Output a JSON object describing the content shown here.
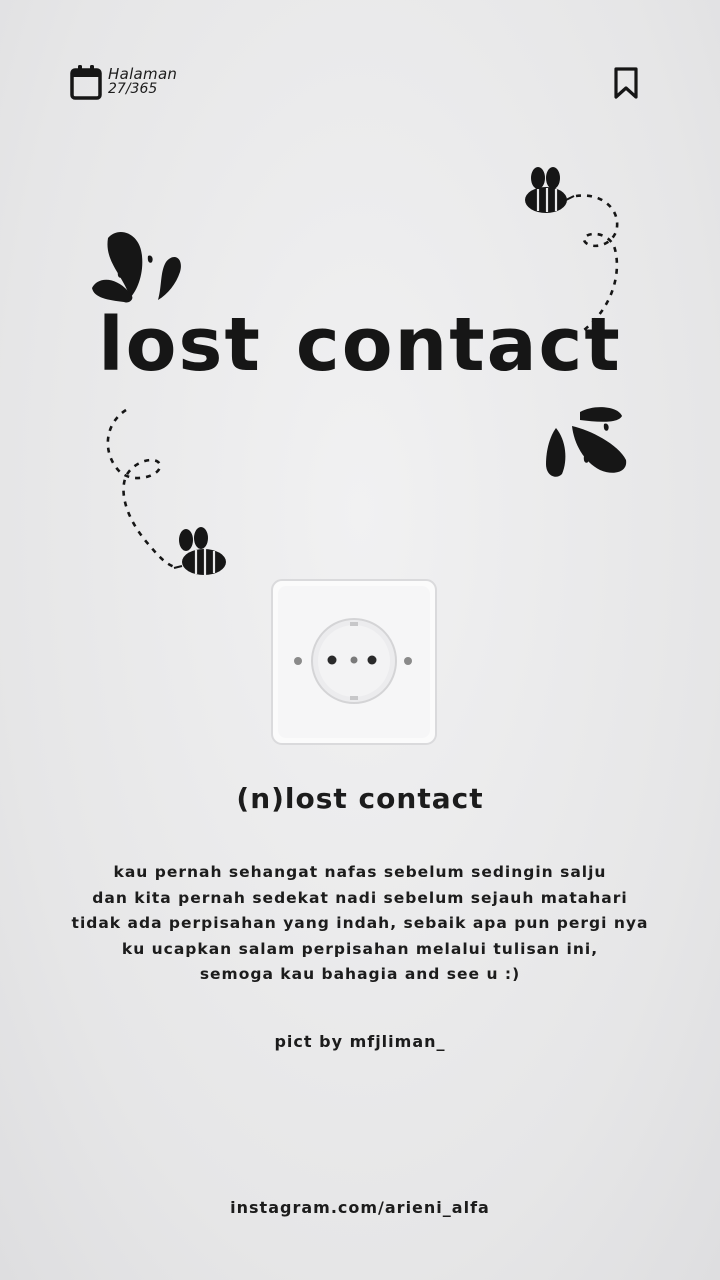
{
  "header": {
    "page_label": "Halaman",
    "page_number": "27/365",
    "calendar_icon": "calendar-icon",
    "bookmark_icon": "bookmark-icon"
  },
  "title": {
    "word1": "lost",
    "word2": "contact"
  },
  "definition": "(n)lost contact",
  "poem": [
    "kau pernah sehangat nafas sebelum sedingin salju",
    "dan kita pernah sedekat nadi sebelum sejauh matahari",
    "tidak ada perpisahan yang indah, sebaik apa pun pergi nya",
    "ku ucapkan salam perpisahan melalui tulisan ini,",
    "semoga kau bahagia and see u :)"
  ],
  "credit": "pict by mfjliman_",
  "footer": "instagram.com/arieni_alfa",
  "colors": {
    "ink": "#161616",
    "paper": "#e9e9ea"
  }
}
